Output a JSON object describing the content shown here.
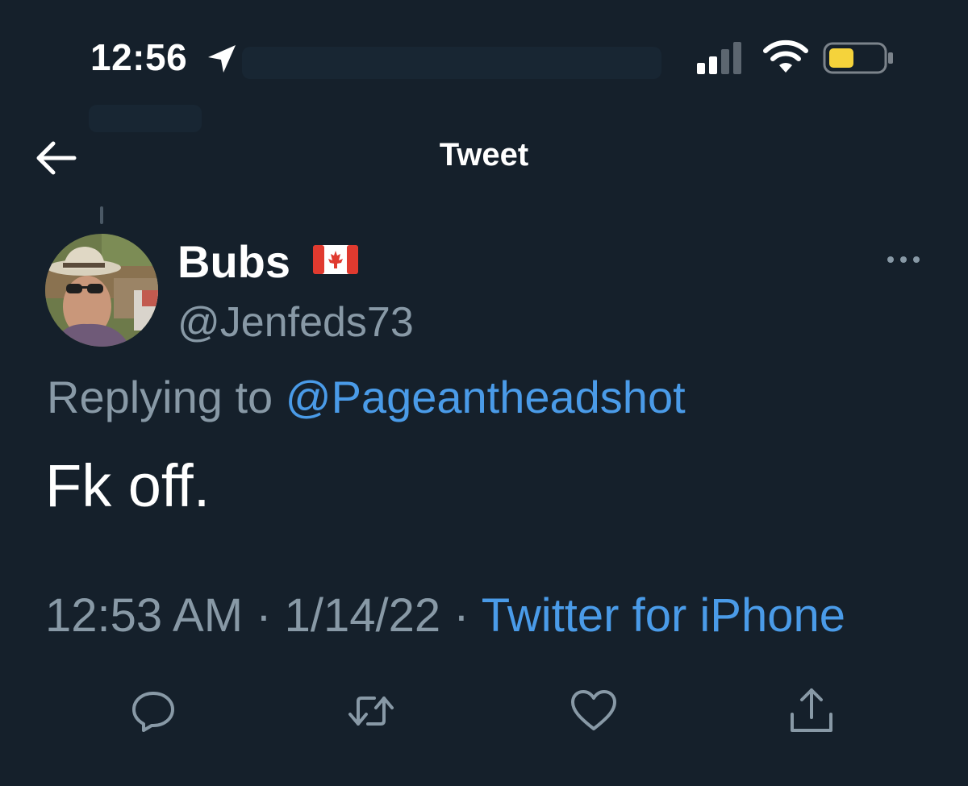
{
  "status_bar": {
    "time": "12:56",
    "icons": [
      "location-arrow-icon",
      "signal-icon",
      "wifi-icon",
      "battery-icon"
    ],
    "battery_color": "#f5d33b"
  },
  "header": {
    "title": "Tweet",
    "back_icon": "arrow-left-icon"
  },
  "tweet": {
    "author": {
      "display_name": "Bubs",
      "flag_icon": "canada-flag-icon",
      "handle": "@Jenfeds73"
    },
    "replying_prefix": "Replying to",
    "replying_to": "@Pageantheadshot",
    "text": "Fk off.",
    "time": "12:53 AM",
    "separator": "·",
    "date": "1/14/22",
    "source": "Twitter for iPhone",
    "more_icon": "more-dots-icon"
  },
  "actions": [
    {
      "icon": "reply-icon"
    },
    {
      "icon": "retweet-icon"
    },
    {
      "icon": "like-icon"
    },
    {
      "icon": "share-icon"
    }
  ],
  "colors": {
    "background": "#15202b",
    "secondary_text": "#8899a6",
    "link": "#4a9be8"
  }
}
